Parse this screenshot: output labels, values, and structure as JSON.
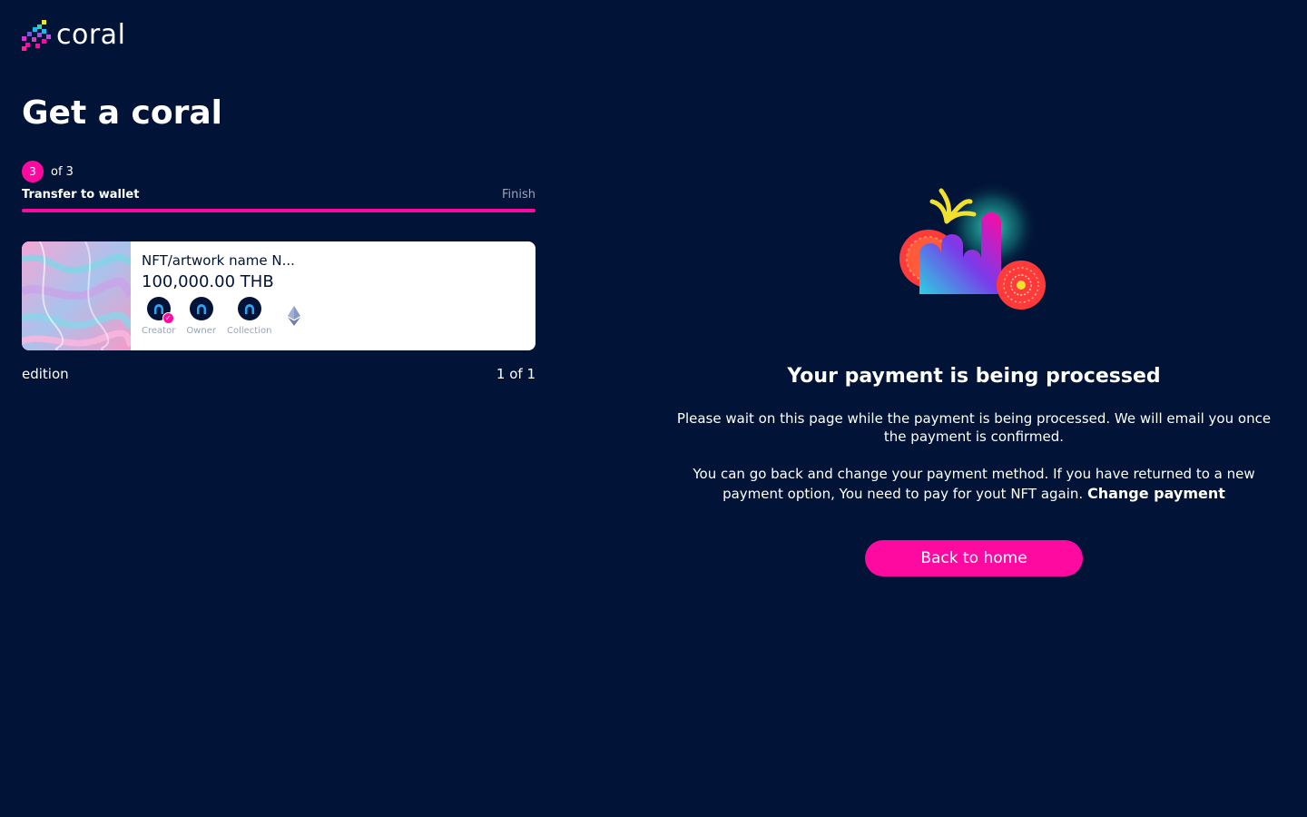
{
  "brand": {
    "logo_text": "coral"
  },
  "page": {
    "title": "Get a coral"
  },
  "stepper": {
    "current": "3",
    "total_label": "of 3",
    "current_label": "Transfer to wallet",
    "final_label": "Finish",
    "progress": 1.0
  },
  "nft": {
    "name": "NFT/artwork name N...",
    "price": "100,000.00 THB",
    "roles": [
      {
        "label": "Creator",
        "verified": true
      },
      {
        "label": "Owner",
        "verified": false
      },
      {
        "label": "Collection",
        "verified": false
      }
    ],
    "chain_icon": "ethereum-icon"
  },
  "edition": {
    "label": "edition",
    "value": "1 of 1"
  },
  "status": {
    "title": "Your payment is being processed",
    "message": "Please wait on this page while the payment is being processed. We will email you once the payment is confirmed.",
    "message2": "You can go back and change your payment method. If you have returned to a new payment option, You need to pay for yout NFT again.",
    "change_link": "Change payment",
    "button_label": "Back to home"
  },
  "colors": {
    "background": "#011437",
    "accent": "#ff0aa0",
    "card": "#ffffff",
    "muted": "#9aa4b8"
  }
}
